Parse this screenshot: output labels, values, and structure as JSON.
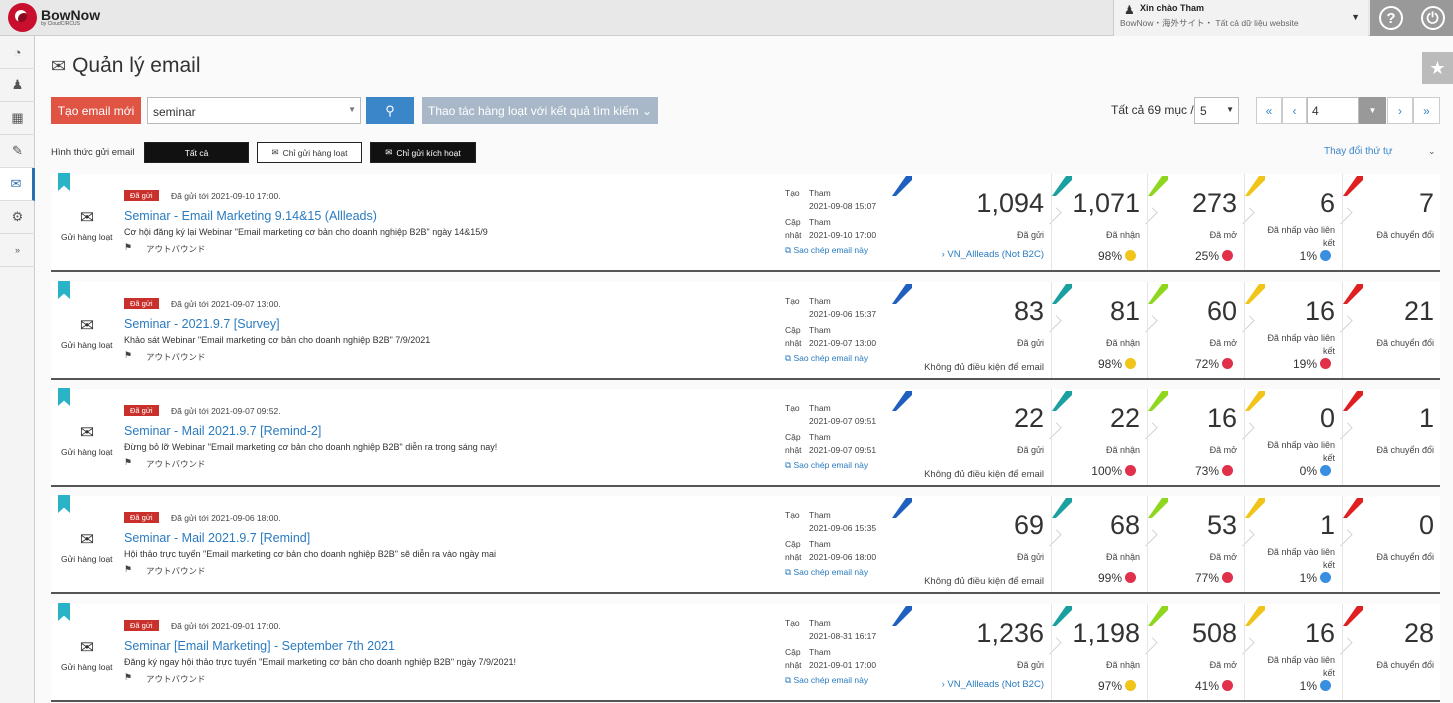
{
  "header": {
    "logo_text": "BowNow",
    "logo_sub": "by CloudCIRCUS",
    "user_greeting": "Xin chào Tham",
    "user_site": "BowNow・海外サイト・ Tất cả dữ liệu website",
    "help_icon": "help-icon",
    "power_icon": "power-icon"
  },
  "page": {
    "title": "Quản lý email"
  },
  "toolbar": {
    "new_email": "Tạo email mới",
    "search_value": "seminar",
    "bulk_action": "Thao tác hàng loạt với kết quả tìm kiếm ⌄",
    "total": "Tất cả 69 mục /",
    "per_page": "5",
    "page_value": "4",
    "first": "«",
    "prev": "‹",
    "next": "›",
    "last": "»"
  },
  "filter": {
    "label": "Hình thức gửi email",
    "all": "Tất cả",
    "bulk_only": "Chỉ gửi hàng loạt",
    "trigger_only": "Chỉ gửi kích hoạt",
    "sort": "Thay đổi thứ tự"
  },
  "labels": {
    "type": "Gửi hàng loạt",
    "badge": "Đã gửi",
    "tag": "アウトバウンド",
    "created": "Tạo",
    "updated_1": "Cập",
    "updated_2": "nhật",
    "copy": "Sao chép email này",
    "sent": "Đã gửi",
    "received": "Đã nhận",
    "opened": "Đã mở",
    "clicked": "Đã nhấp vào liên kết",
    "converted": "Đã chuyển đổi"
  },
  "colors": {
    "sent": "#1f5fbf",
    "received": "#1aa0a0",
    "opened": "#8fd61f",
    "clicked": "#f0c419",
    "converted": "#e02020",
    "good": "#f0c419",
    "bad": "#e0304a",
    "info": "#3a8ee0"
  },
  "emails": [
    {
      "sent_at": "Đã gửi tới 2021-09-10 17:00.",
      "subject": "Seminar - Email Marketing 9.14&15 (Allleads)",
      "desc": "Cơ hội đăng ký lại Webinar \"Email marketing cơ bản cho doanh nghiệp B2B\" ngày 14&15/9",
      "creator": "Tham",
      "created": "2021-09-08 15:07",
      "updater": "Tham",
      "updated": "2021-09-10 17:00",
      "sent": "1,094",
      "segment": "VN_Allleads (Not B2C)",
      "received": "1,071",
      "received_rate": "98%",
      "received_status": "good",
      "opened": "273",
      "opened_rate": "25%",
      "opened_status": "bad",
      "clicked": "6",
      "clicked_rate": "1%",
      "clicked_status": "info",
      "converted": "7"
    },
    {
      "sent_at": "Đã gửi tới 2021-09-07 13:00.",
      "subject": "Seminar - 2021.9.7 [Survey]",
      "desc": "Khảo sát Webinar \"Email marketing cơ bản cho doanh nghiệp B2B\" 7/9/2021",
      "creator": "Tham",
      "created": "2021-09-06 15:37",
      "updater": "Tham",
      "updated": "2021-09-07 13:00",
      "sent": "83",
      "segment": "Không đủ điều kiện để email",
      "received": "81",
      "received_rate": "98%",
      "received_status": "good",
      "opened": "60",
      "opened_rate": "72%",
      "opened_status": "bad",
      "clicked": "16",
      "clicked_rate": "19%",
      "clicked_status": "bad",
      "converted": "21"
    },
    {
      "sent_at": "Đã gửi tới 2021-09-07 09:52.",
      "subject": "Seminar - Mail 2021.9.7 [Remind-2]",
      "desc": "Đừng bỏ lỡ Webinar \"Email marketing cơ bản cho doanh nghiệp B2B\" diễn ra trong sáng nay!",
      "creator": "Tham",
      "created": "2021-09-07 09:51",
      "updater": "Tham",
      "updated": "2021-09-07 09:51",
      "sent": "22",
      "segment": "Không đủ điều kiện để email",
      "received": "22",
      "received_rate": "100%",
      "received_status": "bad",
      "opened": "16",
      "opened_rate": "73%",
      "opened_status": "bad",
      "clicked": "0",
      "clicked_rate": "0%",
      "clicked_status": "info",
      "converted": "1"
    },
    {
      "sent_at": "Đã gửi tới 2021-09-06 18:00.",
      "subject": "Seminar - Mail 2021.9.7 [Remind]",
      "desc": "Hội thảo trực tuyến \"Email marketing cơ bản cho doanh nghiệp B2B\" sẽ diễn ra vào ngày mai",
      "creator": "Tham",
      "created": "2021-09-06 15:35",
      "updater": "Tham",
      "updated": "2021-09-06 18:00",
      "sent": "69",
      "segment": "Không đủ điều kiện để email",
      "received": "68",
      "received_rate": "99%",
      "received_status": "bad",
      "opened": "53",
      "opened_rate": "77%",
      "opened_status": "bad",
      "clicked": "1",
      "clicked_rate": "1%",
      "clicked_status": "info",
      "converted": "0"
    },
    {
      "sent_at": "Đã gửi tới 2021-09-01 17:00.",
      "subject": "Seminar [Email Marketing] - September 7th 2021",
      "desc": "Đăng ký ngay hội thảo trực tuyến \"Email marketing cơ bản cho doanh nghiệp B2B\" ngày 7/9/2021!",
      "creator": "Tham",
      "created": "2021-08-31 16:17",
      "updater": "Tham",
      "updated": "2021-09-01 17:00",
      "sent": "1,236",
      "segment": "VN_Allleads (Not B2C)",
      "received": "1,198",
      "received_rate": "97%",
      "received_status": "good",
      "opened": "508",
      "opened_rate": "41%",
      "opened_status": "bad",
      "clicked": "16",
      "clicked_rate": "1%",
      "clicked_status": "info",
      "converted": "28"
    }
  ]
}
